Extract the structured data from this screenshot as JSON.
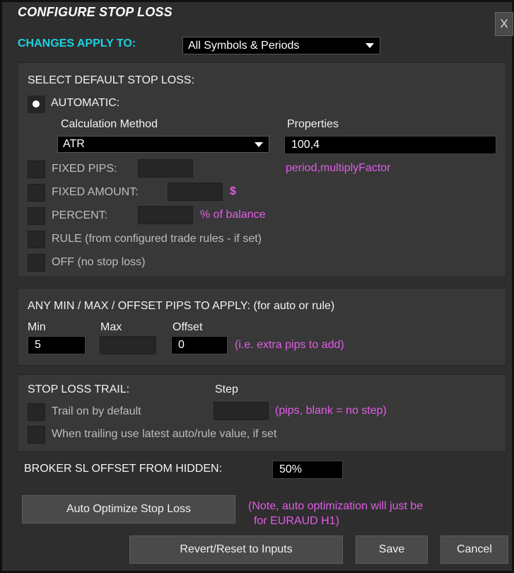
{
  "header": {
    "title": "CONFIGURE STOP LOSS",
    "close_label": "X",
    "apply_label": "CHANGES APPLY TO:",
    "apply_value": "All Symbols & Periods"
  },
  "default_section": {
    "heading": "SELECT DEFAULT STOP LOSS:",
    "automatic": {
      "label": "AUTOMATIC:",
      "selected": true
    },
    "calc_method_label": "Calculation Method",
    "calc_method_value": "ATR",
    "properties_label": "Properties",
    "properties_value": "100,4",
    "properties_hint": "period,multiplyFactor",
    "fixed_pips_label": "FIXED PIPS:",
    "fixed_amount_label": "FIXED AMOUNT:",
    "fixed_amount_unit": "$",
    "percent_label": "PERCENT:",
    "percent_unit": "% of balance",
    "rule_label": "RULE (from configured trade rules - if set)",
    "off_label": "OFF (no stop loss)"
  },
  "minmax_section": {
    "heading": "ANY MIN / MAX / OFFSET PIPS TO APPLY: (for auto or rule)",
    "min_label": "Min",
    "min_value": "5",
    "max_label": "Max",
    "max_value": "",
    "offset_label": "Offset",
    "offset_value": "0",
    "offset_hint": "(i.e. extra pips to add)"
  },
  "trail_section": {
    "heading": "STOP LOSS TRAIL:",
    "step_label": "Step",
    "trail_default_label": "Trail on by default",
    "step_hint": "(pips, blank = no step)",
    "latest_value_label": "When trailing use latest auto/rule value, if set"
  },
  "broker": {
    "label": "BROKER SL OFFSET FROM HIDDEN:",
    "value": "50%"
  },
  "actions": {
    "optimize_label": "Auto Optimize Stop Loss",
    "optimize_note_line1": "(Note, auto optimization will just be",
    "optimize_note_line2": "for EURAUD H1)",
    "revert_label": "Revert/Reset to Inputs",
    "save_label": "Save",
    "cancel_label": "Cancel"
  },
  "colors": {
    "accent_cyan": "#19d3e0",
    "hint_pink": "#e05de6",
    "panel_bg": "#2e2e2e",
    "section_bg": "#383838"
  }
}
